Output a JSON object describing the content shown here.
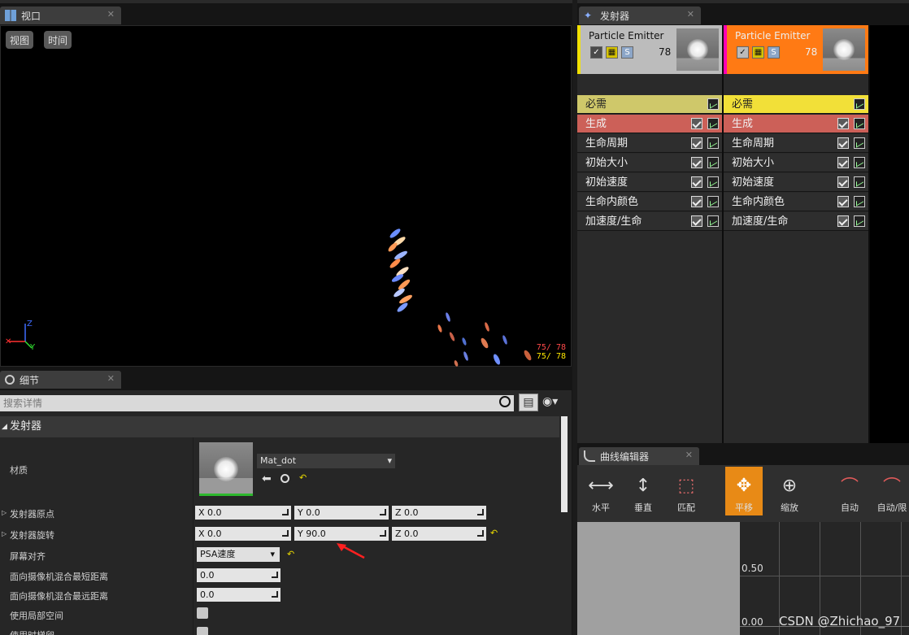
{
  "viewport_tab": {
    "title": "视口"
  },
  "viewport": {
    "buttons": [
      "视图",
      "时间"
    ],
    "stats": [
      "75/ 78",
      "75/ 78"
    ],
    "axis_labels": {
      "z": "Z",
      "y": "Y"
    }
  },
  "emitter_tab": {
    "title": "发射器"
  },
  "emitters": [
    {
      "name": "Particle Emitter",
      "count": "78",
      "head_color": "#bcbcbc",
      "accent": "#f3e200",
      "icon_s": "S"
    },
    {
      "name": "Particle Emitter",
      "count": "78",
      "head_color": "#ff7a14",
      "accent": "#ff00b4",
      "icon_s": "S"
    }
  ],
  "modules": [
    "必需",
    "生成",
    "生命周期",
    "初始大小",
    "初始速度",
    "生命内颜色",
    "加速度/生命"
  ],
  "details_tab": {
    "title": "细节"
  },
  "details": {
    "search_placeholder": "搜索详情",
    "category": "发射器",
    "rows": {
      "material": "材质",
      "origin": "发射器原点",
      "rotation": "发射器旋转",
      "screen_align": "屏幕对齐",
      "cam_min": "面向摄像机混合最短距离",
      "cam_max": "面向摄像机混合最远距离",
      "local_space": "使用局部空间",
      "last_row": "使用时梯卵"
    },
    "material_value": "Mat_dot",
    "origin_values": [
      "X  0.0",
      "Y  0.0",
      "Z  0.0"
    ],
    "rotation_values": [
      "X  0.0",
      "Y  90.0",
      "Z  0.0"
    ],
    "screen_align_value": "PSA速度",
    "cam_min_value": "0.0",
    "cam_max_value": "0.0"
  },
  "curve_tab": {
    "title": "曲线编辑器"
  },
  "curve_tools": [
    "水平",
    "垂直",
    "匹配",
    "平移",
    "缩放",
    "自动",
    "自动/限"
  ],
  "curve_labels": [
    "0.50",
    "0.00"
  ],
  "watermark": "CSDN @Zhichao_97"
}
